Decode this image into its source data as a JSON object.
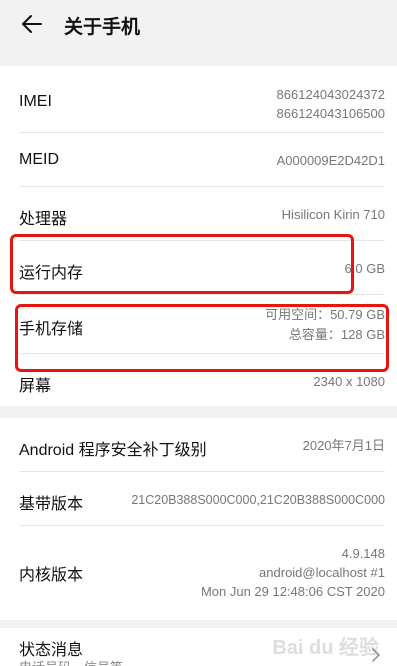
{
  "header": {
    "title": "关于手机"
  },
  "rows": {
    "imei": {
      "label": "IMEI",
      "value1": "866124043024372",
      "value2": "866124043106500"
    },
    "meid": {
      "label": "MEID",
      "value": "A000009E2D42D1"
    },
    "cpu": {
      "label": "处理器",
      "value": "Hisilicon Kirin 710"
    },
    "ram": {
      "label": "运行内存",
      "value": "6.0 GB"
    },
    "storage": {
      "label": "手机存储",
      "available": "可用空间：50.79  GB",
      "total": "总容量：128  GB"
    },
    "screen": {
      "label": "屏幕",
      "value": "2340 x 1080"
    },
    "security_patch": {
      "label": "Android 程序安全补丁级别",
      "value": "2020年7月1日"
    },
    "baseband": {
      "label": "基带版本",
      "value": "21C20B388S000C000,21C20B388S000C000"
    },
    "kernel": {
      "label": "内核版本",
      "line1": "4.9.148",
      "line2": "android@localhost #1",
      "line3": "Mon Jun 29 12:48:06 CST 2020"
    },
    "status": {
      "label": "状态消息",
      "sub": "电话号码，信号等"
    }
  },
  "colors": {
    "highlight": "#e6150f",
    "background": "#f2f2f2",
    "card": "#ffffff"
  }
}
